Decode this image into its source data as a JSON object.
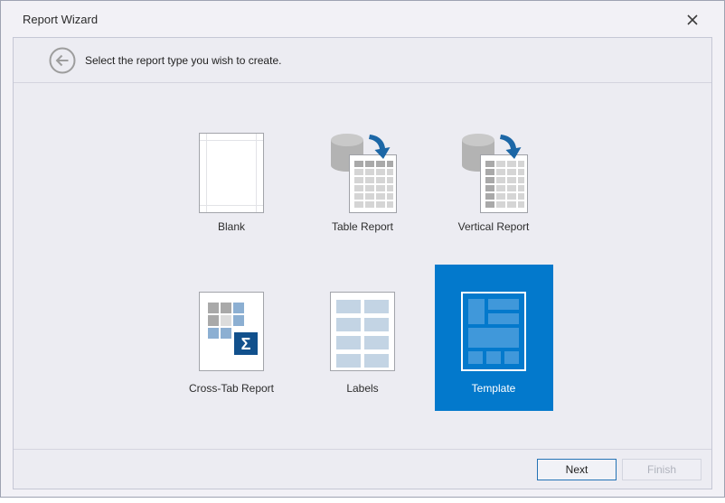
{
  "window": {
    "title": "Report Wizard"
  },
  "header": {
    "instruction": "Select the report type you wish to create."
  },
  "tiles": [
    {
      "id": "blank",
      "label": "Blank",
      "selected": false
    },
    {
      "id": "table-report",
      "label": "Table Report",
      "selected": false
    },
    {
      "id": "vertical-report",
      "label": "Vertical Report",
      "selected": false
    },
    {
      "id": "cross-tab-report",
      "label": "Cross-Tab Report",
      "selected": false
    },
    {
      "id": "labels",
      "label": "Labels",
      "selected": false
    },
    {
      "id": "template",
      "label": "Template",
      "selected": true
    }
  ],
  "footer": {
    "next_label": "Next",
    "finish_label": "Finish",
    "finish_enabled": false
  },
  "icons": {
    "sigma": "Σ"
  },
  "colors": {
    "selected_tile_blue": "#0379cc",
    "selected_tile_block_blue": "#4098da",
    "next_button_border": "#2473b5",
    "arrow_blue": "#1c67a6",
    "crosstab_blue": "#8cafd2",
    "sigma_navy": "#11508c",
    "labels_blue": "#c3d4e4",
    "grid_header_gray": "#a9a9a9",
    "grid_cell_gray": "#d5d5d5",
    "cylinder_gray": "#b3b3b3",
    "panel_bg": "#ececf2",
    "chrome_bg": "#f2f1f6"
  }
}
